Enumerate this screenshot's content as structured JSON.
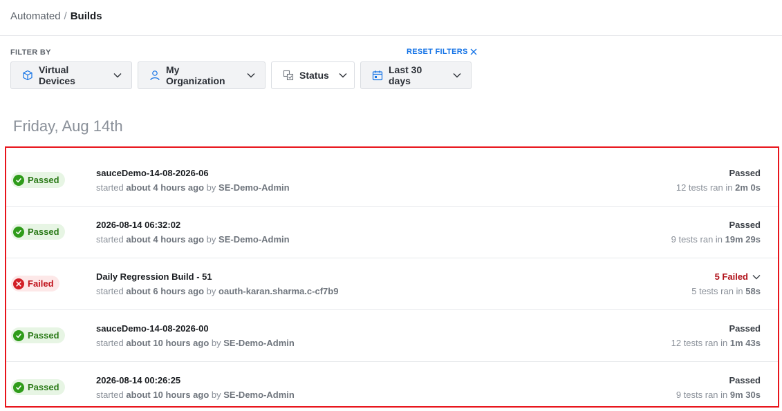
{
  "breadcrumb": {
    "parent": "Automated",
    "separator": "/",
    "current": "Builds"
  },
  "filters": {
    "label": "FILTER BY",
    "reset_label": "RESET FILTERS",
    "buttons": [
      {
        "label": "Virtual Devices",
        "icon": "cube-icon"
      },
      {
        "label": "My Organization",
        "icon": "user-icon"
      },
      {
        "label": "Status",
        "icon": "status-icon"
      },
      {
        "label": "Last 30 days",
        "icon": "calendar-icon"
      }
    ]
  },
  "day_heading": "Friday, Aug 14th",
  "builds": [
    {
      "badge": "Passed",
      "name": "sauceDemo-14-08-2026-06",
      "started_prefix": "started",
      "started_when": "about 4 hours ago",
      "by_word": "by",
      "user": "SE-Demo-Admin",
      "status": "Passed",
      "summary_prefix": "12 tests ran in",
      "duration": "2m 0s"
    },
    {
      "badge": "Passed",
      "name": "2026-08-14 06:32:02",
      "started_prefix": "started",
      "started_when": "about 4 hours ago",
      "by_word": "by",
      "user": "SE-Demo-Admin",
      "status": "Passed",
      "summary_prefix": "9 tests ran in",
      "duration": "19m 29s"
    },
    {
      "badge": "Failed",
      "name": "Daily Regression Build - 51",
      "started_prefix": "started",
      "started_when": "about 6 hours ago",
      "by_word": "by",
      "user": "oauth-karan.sharma.c-cf7b9",
      "status": "5 Failed",
      "summary_prefix": "5 tests ran in",
      "duration": "58s"
    },
    {
      "badge": "Passed",
      "name": "sauceDemo-14-08-2026-00",
      "started_prefix": "started",
      "started_when": "about 10 hours ago",
      "by_word": "by",
      "user": "SE-Demo-Admin",
      "status": "Passed",
      "summary_prefix": "12 tests ran in",
      "duration": "1m 43s"
    },
    {
      "badge": "Passed",
      "name": "2026-08-14 00:26:25",
      "started_prefix": "started",
      "started_when": "about 10 hours ago",
      "by_word": "by",
      "user": "SE-Demo-Admin",
      "status": "Passed",
      "summary_prefix": "9 tests ran in",
      "duration": "9m 30s"
    }
  ],
  "colors": {
    "accent": "#1473e6",
    "passed": "#2f9c1a",
    "failed": "#d21f26",
    "highlight": "#e8141b"
  }
}
